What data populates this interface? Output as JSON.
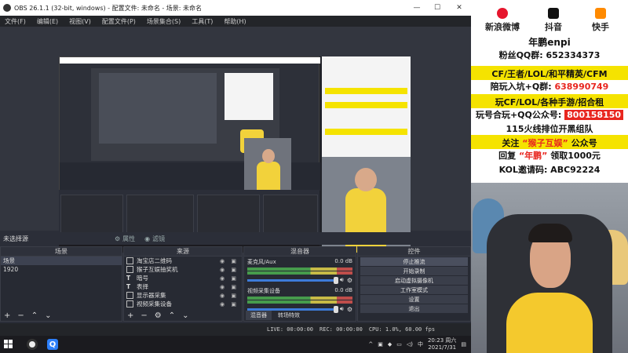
{
  "window": {
    "title": "OBS 26.1.1 (32-bit, windows) - 配置文件: 未命名 - 场景: 未命名",
    "minimize": "—",
    "maximize": "☐",
    "close": "✕"
  },
  "menu": [
    "文件(F)",
    "编辑(E)",
    "视图(V)",
    "配置文件(P)",
    "场景集合(S)",
    "工具(T)",
    "帮助(H)"
  ],
  "no_source": {
    "label": "未选择源",
    "properties": "属性",
    "filters": "滤镜"
  },
  "scenes": {
    "header": "场景",
    "items": [
      "场景",
      "1920"
    ]
  },
  "sources": {
    "header": "来源",
    "items": [
      "淘宝店二维码",
      "猴子互娱抽奖机",
      "暗号",
      "表择",
      "显示器采集",
      "视频采集设备"
    ]
  },
  "mixer": {
    "header": "混音器",
    "tracks": [
      {
        "name": "麦克风/Aux",
        "db": "0.0 dB"
      },
      {
        "name": "视频采集设备",
        "db": "0.0 dB"
      }
    ],
    "tabs": [
      "混音器",
      "转场特效"
    ]
  },
  "controls": {
    "header": "控件",
    "buttons": [
      "停止推流",
      "开始录制",
      "启动虚拟摄像机",
      "工作室模式",
      "设置",
      "退出"
    ]
  },
  "status": {
    "live": "LIVE: 00:00:00",
    "rec": "REC: 00:00:00",
    "cpu": "CPU: 1.0%, 60.00 fps"
  },
  "taskbar": {
    "time": "20:23 周六",
    "date": "2021/7/31",
    "lang": "中"
  },
  "overlay": {
    "socials": [
      {
        "label": "新浪微博",
        "icon": "weibo-icon",
        "color": "#e6162d"
      },
      {
        "label": "抖音",
        "icon": "douyin-icon",
        "color": "#111111"
      },
      {
        "label": "快手",
        "icon": "kuaishou-icon",
        "color": "#ff8a00"
      }
    ],
    "name": "年鹏enpi",
    "fan_qq": "粉丝QQ群:  652334373",
    "games": "CF/王者/LOL/和平精英/CFM",
    "group_prefix": "陪玩入坑+Q群:",
    "group_no": "638990749",
    "play_line": "玩CF/LOL/各种手游/招合租",
    "wechat_prefix": "玩号合玩+QQ公众号:",
    "wechat_no": "800158150",
    "team": "115火线排位开黑组队",
    "follow_a": "关注",
    "follow_b": "“猴子互娱”",
    "follow_c": "公众号",
    "reply_a": "回复",
    "reply_b": "“年鹏”",
    "reply_c": "领取1000元",
    "kol": "KOL邀请码:  ABC92224"
  }
}
